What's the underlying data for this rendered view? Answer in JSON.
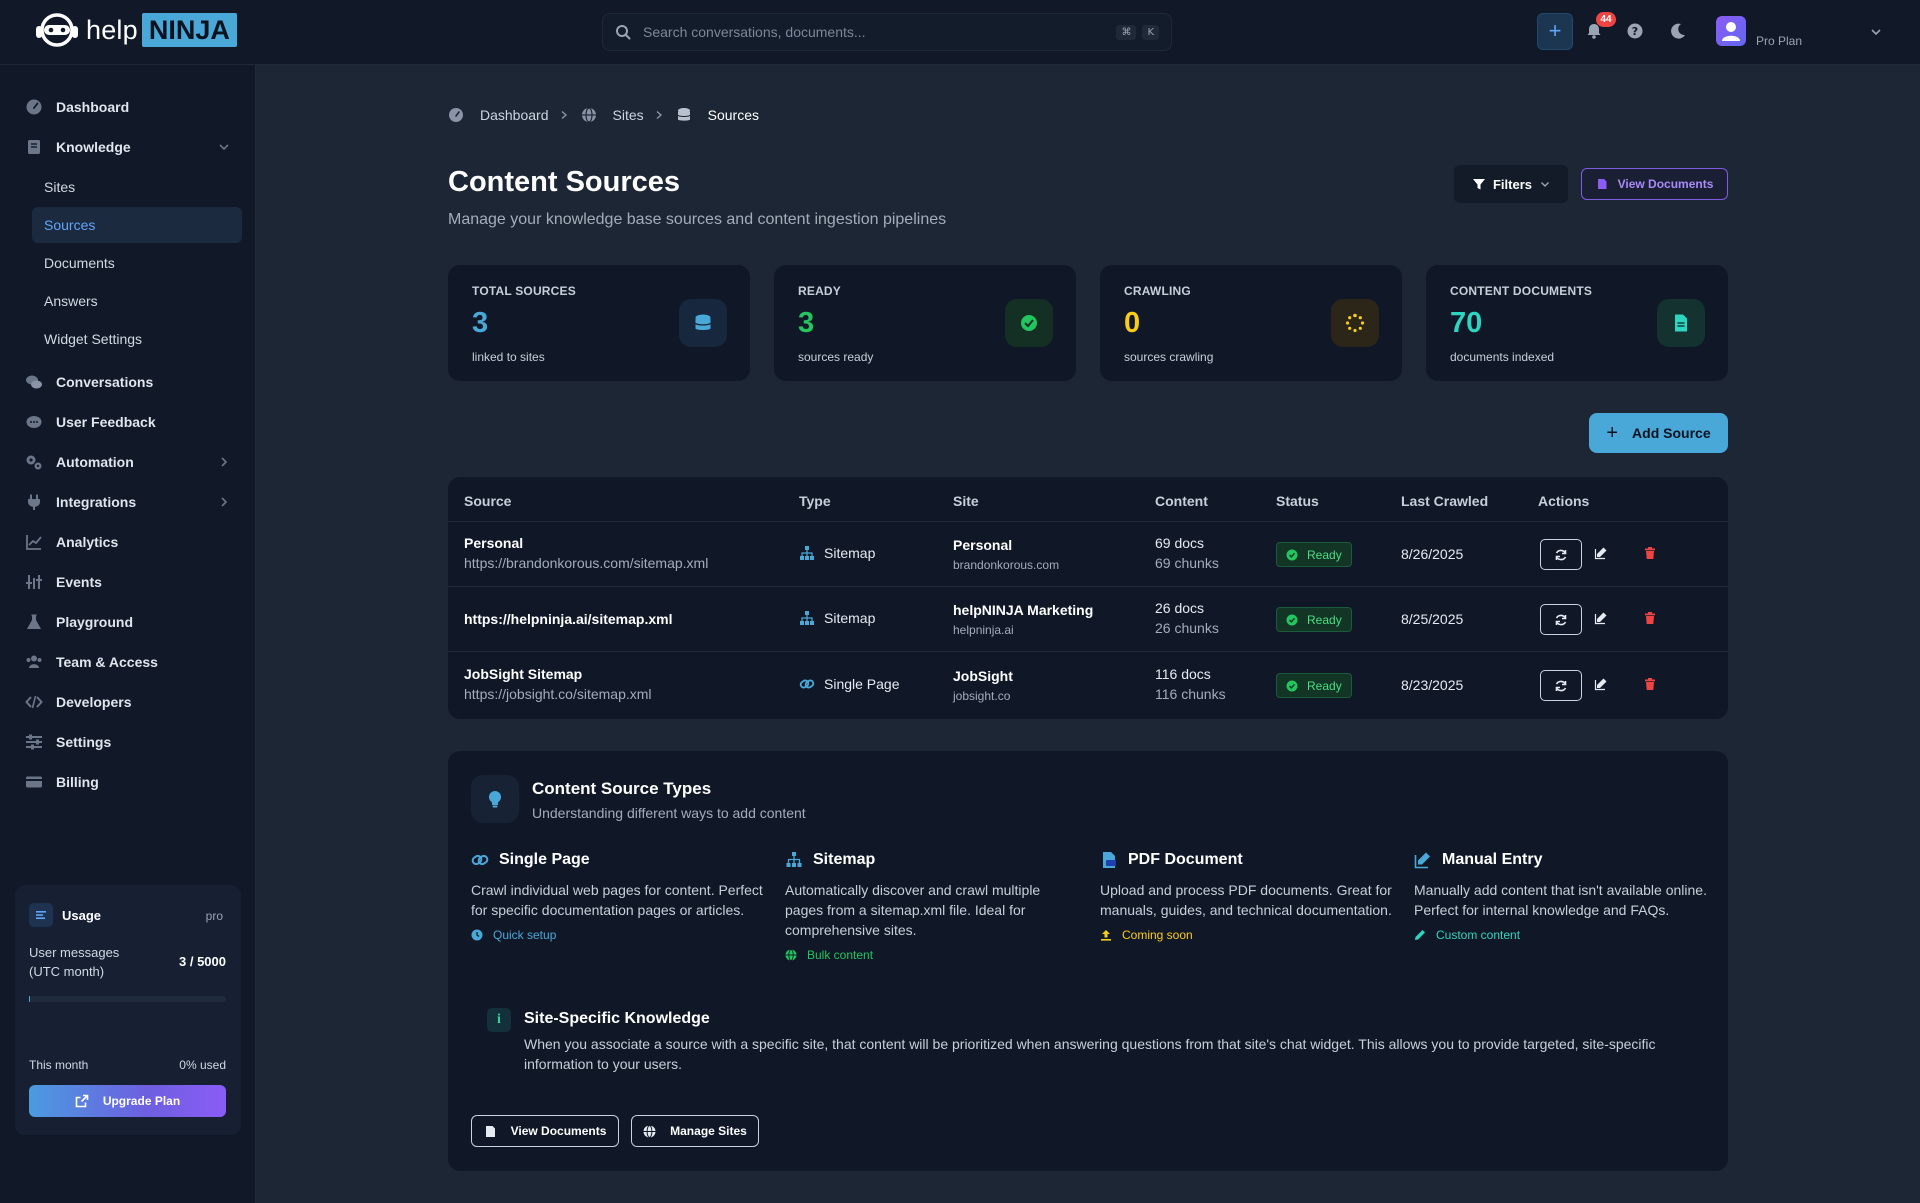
{
  "brand": {
    "help": "help",
    "ninja": "NINJA"
  },
  "header": {
    "search_placeholder": "Search conversations, documents...",
    "kbd_cmd": "⌘",
    "kbd_k": "K",
    "notification_count": "44",
    "plan": "Pro Plan"
  },
  "sidebar": {
    "dashboard": "Dashboard",
    "knowledge": "Knowledge",
    "knowledge_items": [
      "Sites",
      "Sources",
      "Documents",
      "Answers",
      "Widget Settings"
    ],
    "conversations": "Conversations",
    "user_feedback": "User Feedback",
    "automation": "Automation",
    "integrations": "Integrations",
    "analytics": "Analytics",
    "events": "Events",
    "playground": "Playground",
    "team_access": "Team & Access",
    "developers": "Developers",
    "settings": "Settings",
    "billing": "Billing",
    "usage": {
      "title": "Usage",
      "tier": "pro",
      "label_line1": "User messages",
      "label_line2": "(UTC month)",
      "count": "3 / 5000",
      "fraction_used": 0.0006,
      "period": "This month",
      "percent": "0% used",
      "upgrade": "Upgrade Plan"
    }
  },
  "breadcrumb": [
    "Dashboard",
    "Sites",
    "Sources"
  ],
  "page": {
    "title": "Content Sources",
    "subtitle": "Manage your knowledge base sources and content ingestion pipelines",
    "filters": "Filters",
    "view_documents": "View Documents",
    "add_source": "Add Source"
  },
  "stats": [
    {
      "label": "TOTAL SOURCES",
      "value": "3",
      "sub": "linked to sites",
      "color": "#4aa8d8"
    },
    {
      "label": "READY",
      "value": "3",
      "sub": "sources ready",
      "color": "#22c55e"
    },
    {
      "label": "CRAWLING",
      "value": "0",
      "sub": "sources crawling",
      "color": "#facc15"
    },
    {
      "label": "CONTENT DOCUMENTS",
      "value": "70",
      "sub": "documents indexed",
      "color": "#2dd4bf"
    }
  ],
  "table": {
    "headers": [
      "Source",
      "Type",
      "Site",
      "Content",
      "Status",
      "Last Crawled",
      "Actions"
    ],
    "rows": [
      {
        "title": "Personal",
        "url": "https://brandonkorous.com/sitemap.xml",
        "type": "Sitemap",
        "site": "Personal",
        "domain": "brandonkorous.com",
        "docs": "69 docs",
        "chunks": "69 chunks",
        "status": "Ready",
        "date": "8/26/2025"
      },
      {
        "title": "https://helpninja.ai/sitemap.xml",
        "url": "",
        "type": "Sitemap",
        "site": "helpNINJA Marketing",
        "domain": "helpninja.ai",
        "docs": "26 docs",
        "chunks": "26 chunks",
        "status": "Ready",
        "date": "8/25/2025"
      },
      {
        "title": "JobSight Sitemap",
        "url": "https://jobsight.co/sitemap.xml",
        "type": "Single Page",
        "site": "JobSight",
        "domain": "jobsight.co",
        "docs": "116 docs",
        "chunks": "116 chunks",
        "status": "Ready",
        "date": "8/23/2025"
      }
    ]
  },
  "types": {
    "title": "Content Source Types",
    "subtitle": "Understanding different ways to add content",
    "items": [
      {
        "title": "Single Page",
        "desc": "Crawl individual web pages for content. Perfect for specific documentation pages or articles.",
        "tag": "Quick setup",
        "tag_color": "#4aa8d8"
      },
      {
        "title": "Sitemap",
        "desc": "Automatically discover and crawl multiple pages from a sitemap.xml file. Ideal for comprehensive sites.",
        "tag": "Bulk content",
        "tag_color": "#22c55e"
      },
      {
        "title": "PDF Document",
        "desc": "Upload and process PDF documents. Great for manuals, guides, and technical documentation.",
        "tag": "Coming soon",
        "tag_color": "#facc15"
      },
      {
        "title": "Manual Entry",
        "desc": "Manually add content that isn't available online. Perfect for internal knowledge and FAQs.",
        "tag": "Custom content",
        "tag_color": "#2dd4bf"
      }
    ],
    "ssk_icon": "i",
    "ssk_title": "Site-Specific Knowledge",
    "ssk_text": "When you associate a source with a specific site, that content will be prioritized when answering questions from that site's chat widget. This allows you to provide targeted, site-specific information to your users.",
    "view_documents": "View Documents",
    "manage_sites": "Manage Sites"
  },
  "icons": {
    "dashboard": "gauge-icon",
    "knowledge": "book-icon",
    "conversations": "chat-bubbles-icon",
    "feedback": "comment-dots-icon",
    "automation": "gears-icon",
    "integrations": "plug-icon",
    "analytics": "line-chart-icon",
    "events": "sliders-icon",
    "playground": "flask-icon",
    "team": "users-icon",
    "developers": "code-icon",
    "settings": "sliders-h-icon",
    "billing": "credit-card-icon"
  }
}
